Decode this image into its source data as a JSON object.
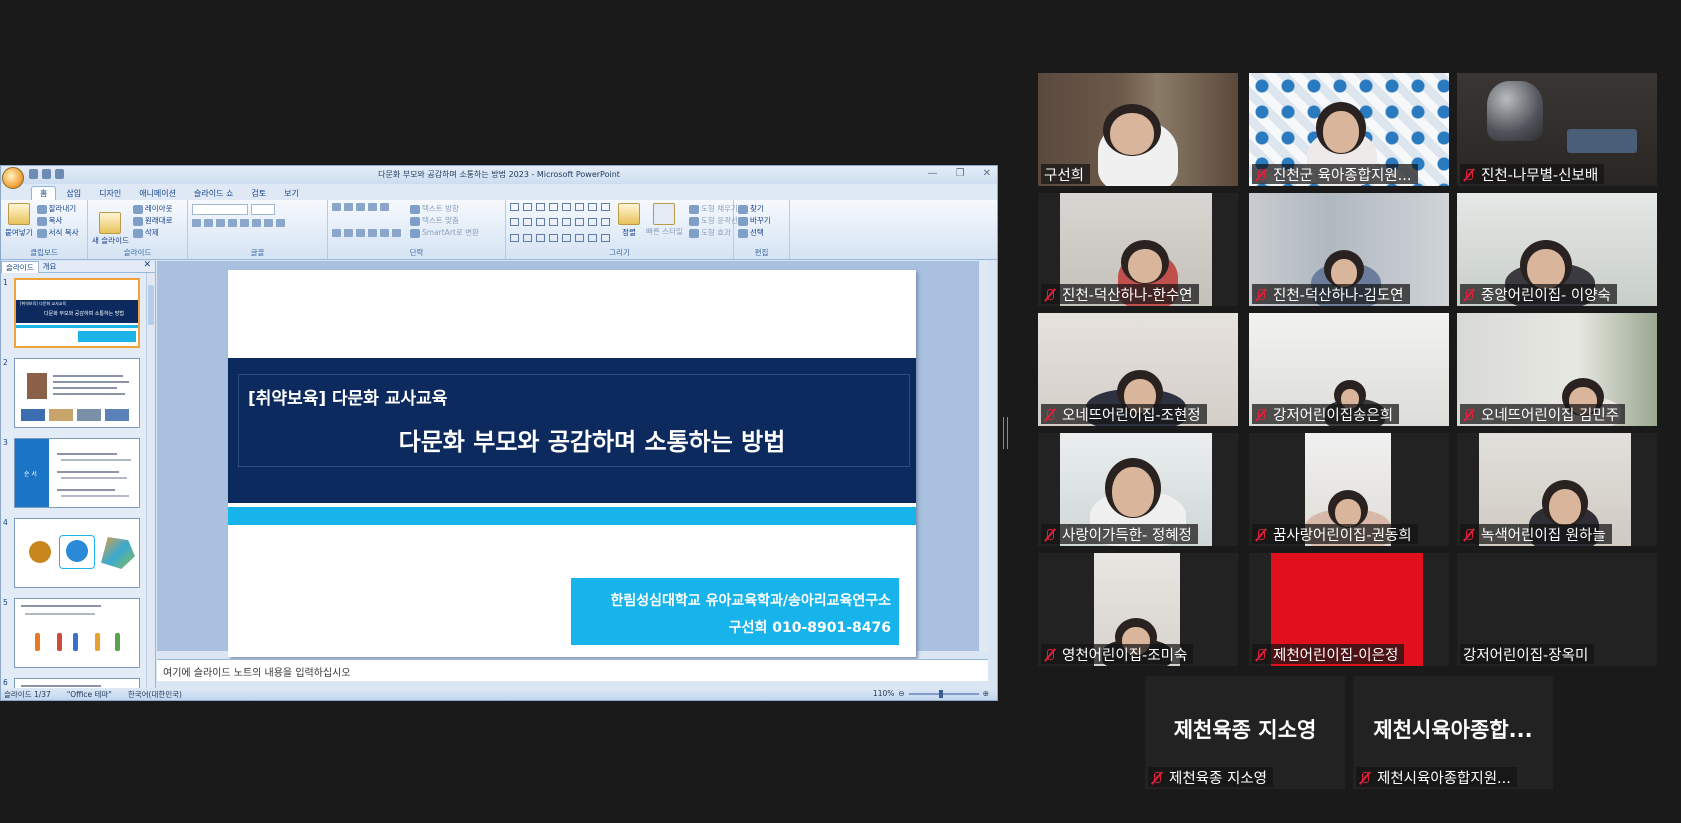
{
  "ppt": {
    "window_title": "다문화 부모와 공감하며 소통하는 방법 2023 - Microsoft PowerPoint",
    "tabs": [
      "홈",
      "삽입",
      "디자인",
      "애니메이션",
      "슬라이드 쇼",
      "검토",
      "보기"
    ],
    "ribbon": {
      "clipboard": {
        "paste": "붙여넣기",
        "cut": "잘라내기",
        "copy": "복사",
        "format_copy": "서식 복사",
        "label": "클립보드"
      },
      "slides": {
        "new_slide": "새\n슬라이드",
        "layout": "레이아웃",
        "reset": "원래대로",
        "delete": "삭제",
        "label": "슬라이드"
      },
      "font": {
        "label": "글꼴"
      },
      "paragraph": {
        "text_direction": "텍스트 방향",
        "align_text": "텍스트 맞춤",
        "smartart": "SmartArt로 변환",
        "label": "단락"
      },
      "drawing": {
        "arrange": "정렬",
        "quick_styles": "빠른\n스타일",
        "fill": "도형 채우기",
        "outline": "도형 윤곽선",
        "effects": "도형 효과",
        "label": "그리기"
      },
      "editing": {
        "find": "찾기",
        "replace": "바꾸기",
        "select": "선택",
        "label": "편집"
      }
    },
    "pane_tabs": [
      "슬라이드",
      "개요"
    ],
    "slide_numbers": [
      "1",
      "2",
      "3",
      "4",
      "5",
      "6"
    ],
    "thumb1": {
      "small_title": "[취약보육] 다문화 교사교육",
      "main_title": "다문화 부모와 공감하며 소통하는 방법"
    },
    "thumb3": {
      "side_label": "순 서"
    },
    "slide": {
      "subtitle": "[취약보육] 다문화 교사교육",
      "title": "다문화 부모와 공감하며 소통하는 방법",
      "affiliation": "한림성심대학교 유아교육학과/송아리교육연구소",
      "contact": "구선희 010-8901-8476"
    },
    "notes_placeholder": "여기에 슬라이드 노트의 내용을 입력하십시오",
    "status": {
      "slide_count": "슬라이드 1/37",
      "theme": "\"Office 테마\"",
      "language": "한국어(대한민국)",
      "zoom": "110%"
    }
  },
  "participants": [
    {
      "name": "구선희",
      "muted": false,
      "speaking": true,
      "video": true
    },
    {
      "name": "진천군 육아종합지원...",
      "muted": true,
      "speaking": false,
      "video": true
    },
    {
      "name": "진천-나무별-신보배",
      "muted": true,
      "speaking": false,
      "video": true
    },
    {
      "name": "진천-덕산하나-한수연",
      "muted": true,
      "speaking": false,
      "video": true
    },
    {
      "name": "진천-덕산하나-김도연",
      "muted": true,
      "speaking": false,
      "video": true
    },
    {
      "name": "중앙어린이집- 이양숙",
      "muted": true,
      "speaking": false,
      "video": true
    },
    {
      "name": "오네뜨어린이집-조현정",
      "muted": true,
      "speaking": false,
      "video": true
    },
    {
      "name": "강저어린이집송은희",
      "muted": true,
      "speaking": false,
      "video": true
    },
    {
      "name": "오네뜨어린이집 김민주",
      "muted": true,
      "speaking": false,
      "video": true
    },
    {
      "name": "사랑이가득한- 정혜정",
      "muted": true,
      "speaking": false,
      "video": true
    },
    {
      "name": "꿈사랑어린이집-권동희",
      "muted": true,
      "speaking": false,
      "video": true
    },
    {
      "name": "녹색어린이집 원하늘",
      "muted": true,
      "speaking": false,
      "video": true
    },
    {
      "name": "영천어린이집-조미숙",
      "muted": true,
      "speaking": false,
      "video": true
    },
    {
      "name": "제천어린이집-이은정",
      "muted": true,
      "speaking": false,
      "video": true
    },
    {
      "name": "강저어린이집-장옥미",
      "muted": false,
      "speaking": false,
      "video": false
    },
    {
      "name": "제천육종 지소영",
      "display_name": "제천육종 지소영",
      "muted": true,
      "speaking": false,
      "video": false
    },
    {
      "name": "제천시육아종합지원...",
      "display_name": "제천시육아종합...",
      "muted": true,
      "speaking": false,
      "video": false
    }
  ],
  "colors": {
    "speaker_border": "#c9e050",
    "muted_icon": "#e0203a",
    "slide_navy": "#0c2a5e",
    "slide_cyan": "#16b4ea"
  }
}
